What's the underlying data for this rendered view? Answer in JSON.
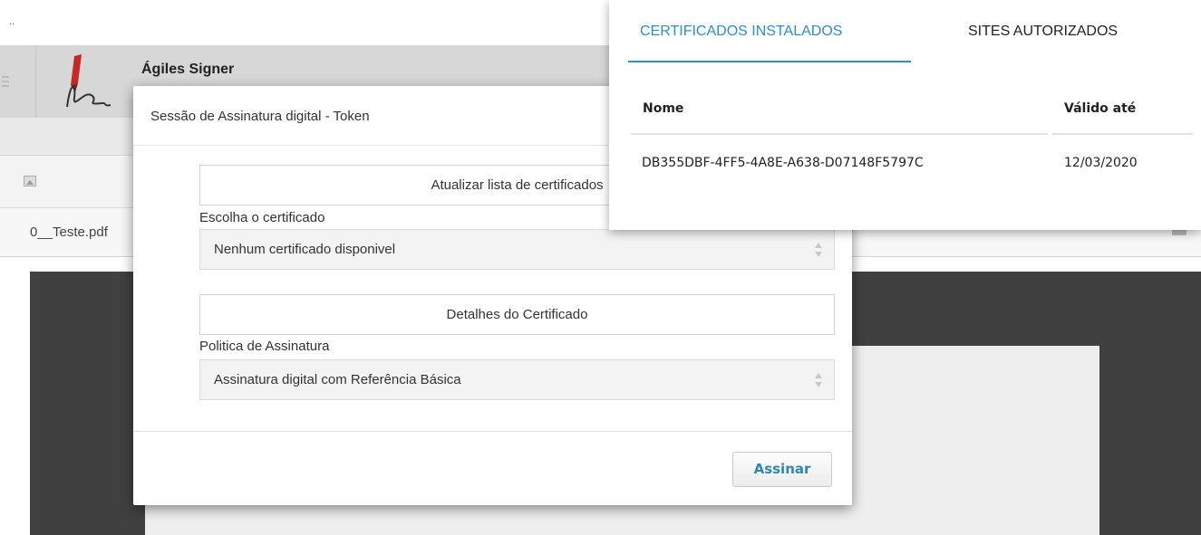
{
  "window": {
    "top_marker": ".."
  },
  "app": {
    "title": "Ágiles Signer",
    "menu_icon": "hamburger-icon",
    "logo_icon": "pen-signature-logo"
  },
  "toolbar": {
    "image_icon": "image-icon"
  },
  "file": {
    "name": "0__Teste.pdf"
  },
  "dialog": {
    "title": "Sessão de Assinatura digital - Token",
    "refresh_button": "Atualizar lista de certificados",
    "certificate_label": "Escolha o certificado",
    "certificate_select": "Nenhum certificado disponivel",
    "details_button": "Detalhes do Certificado",
    "policy_label": "Politica de Assinatura",
    "policy_select": "Assinatura digital com Referência Básica",
    "sign_button": "Assinar"
  },
  "certificates_panel": {
    "tabs": [
      {
        "label": "CERTIFICADOS INSTALADOS",
        "active": true
      },
      {
        "label": "SITES AUTORIZADOS",
        "active": false
      }
    ],
    "columns": [
      "Nome",
      "Válido até"
    ],
    "rows": [
      {
        "name": "DB355DBF-4FF5-4A8E-A638-D07148F5797C",
        "valid_until": "12/03/2020"
      }
    ]
  },
  "colors": {
    "accent": "#2d8fc4",
    "sign_button_text": "#2f88b0",
    "viewer_bg": "#404040"
  }
}
